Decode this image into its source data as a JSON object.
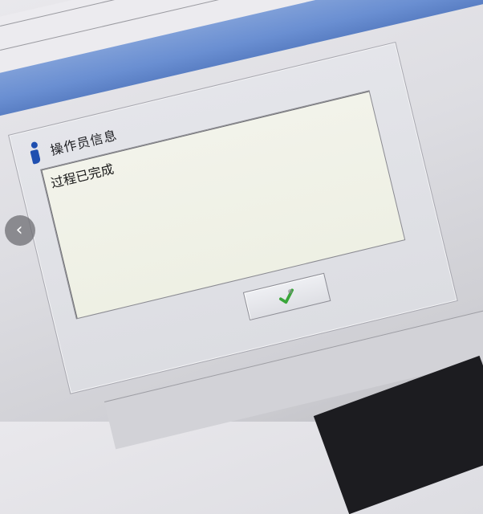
{
  "dialog": {
    "title": "操作员信息",
    "message": "过程已完成",
    "ok_button_icon": "check-icon"
  },
  "overlay": {
    "prev_arrow_glyph": "‹"
  },
  "colors": {
    "info_icon": "#1f4fb0",
    "title_bar": "#6a8fd2",
    "message_background": "#f2f3ea",
    "check_green": "#3aa63a"
  }
}
